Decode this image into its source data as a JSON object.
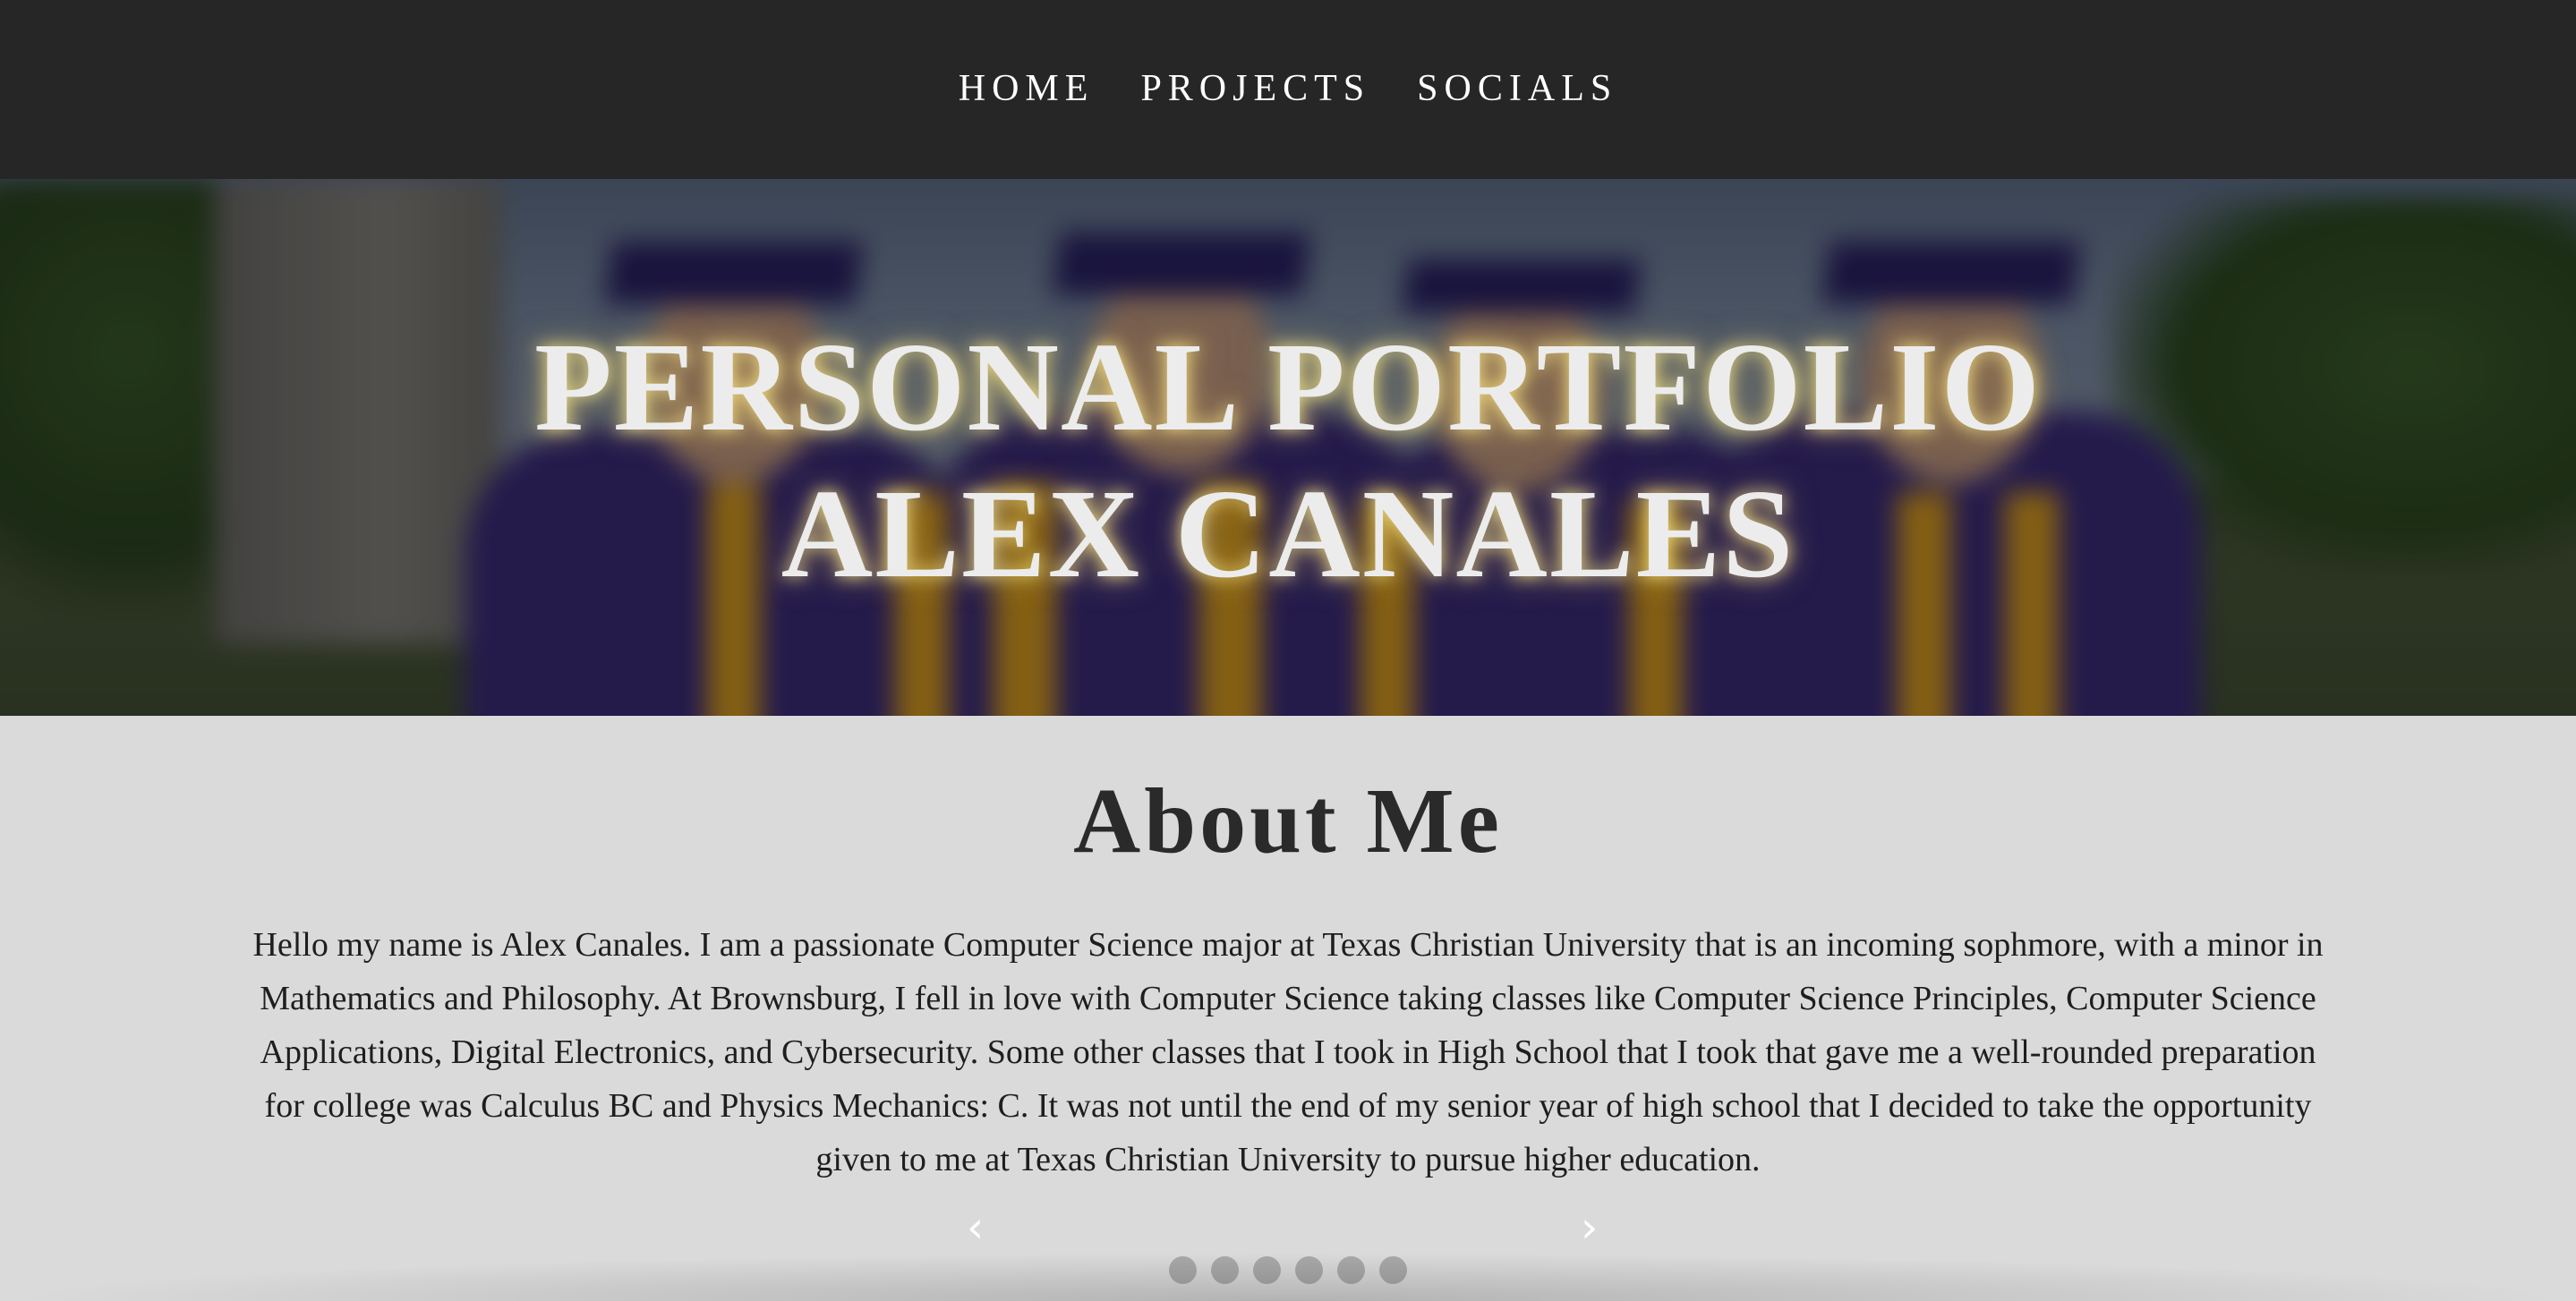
{
  "nav": {
    "items": [
      {
        "label": "HOME"
      },
      {
        "label": "PROJECTS"
      },
      {
        "label": "SOCIALS"
      }
    ]
  },
  "hero": {
    "title_line1": "PERSONAL PORTFOLIO",
    "title_line2": "ALEX CANALES"
  },
  "about": {
    "heading": "About Me",
    "text": "Hello my name is Alex Canales. I am a passionate Computer Science major at Texas Christian University that is an incoming sophmore, with a minor in Mathematics and Philosophy. At Brownsburg, I fell in love with Computer Science taking classes like Computer Science Principles, Computer Science Applications, Digital Electronics, and Cybersecurity. Some other classes that I took in High School that I took that gave me a well-rounded preparation for college was Calculus BC and Physics Mechanics: C. It was not until the end of my senior year of high school that I decided to take the opportunity given to me at Texas Christian University to pursue higher education."
  },
  "carousel": {
    "prev_icon": "‹",
    "next_icon": "›",
    "dot_count": 6
  },
  "colors": {
    "navbar_bg": "#262626",
    "page_bg": "#dadada",
    "hero_text": "#ececec",
    "hero_glow": "#ffe68c",
    "heading_text": "#2a2a2a",
    "dot": "#a9a9a9"
  }
}
